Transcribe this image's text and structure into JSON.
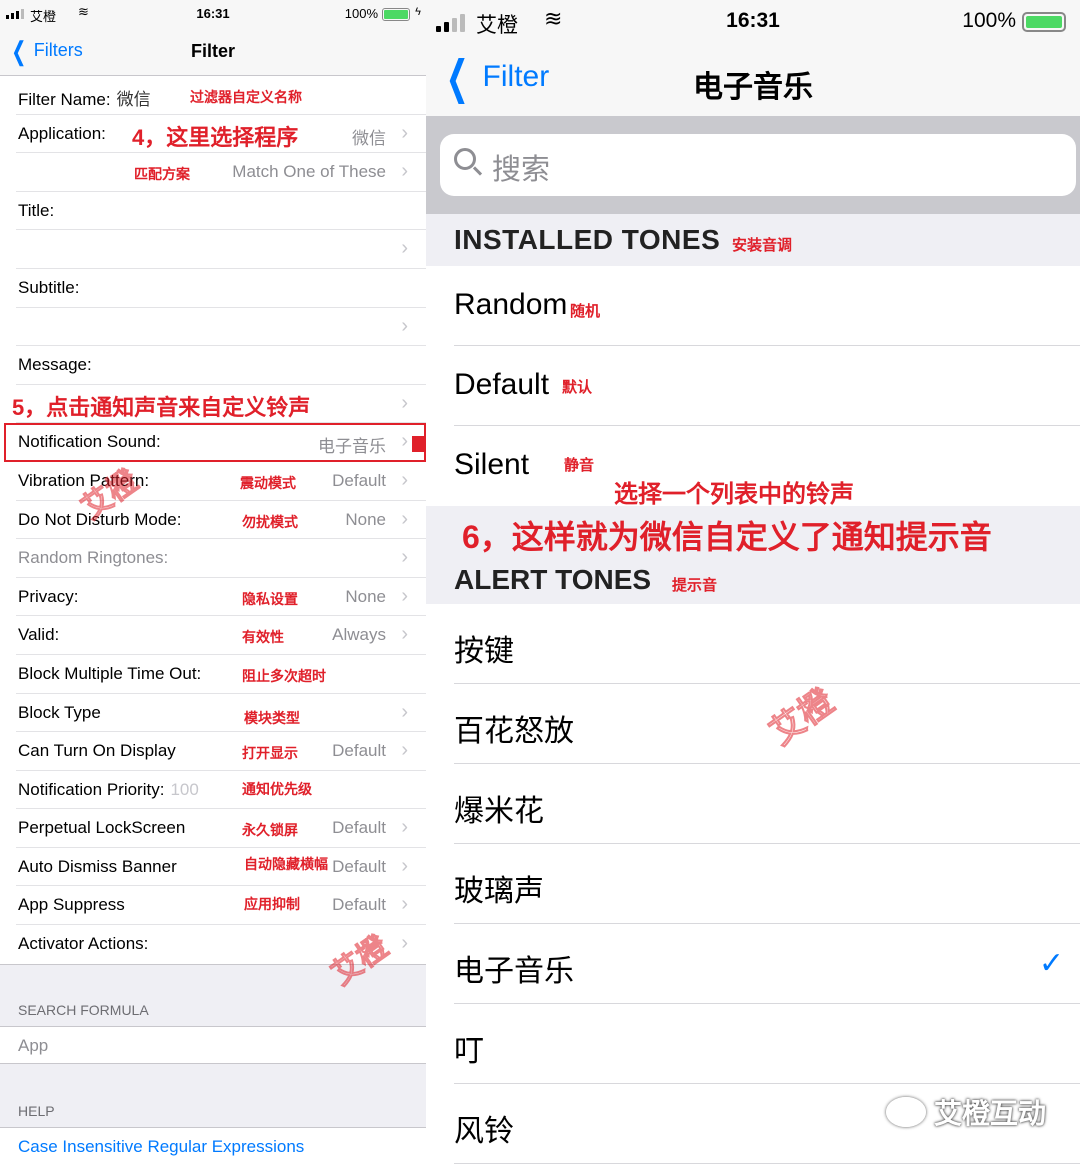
{
  "colors": {
    "accent": "#007aff",
    "annotation": "#e0202a",
    "check": "#007aff"
  },
  "left": {
    "status": {
      "carrier": "艾橙",
      "time": "16:31",
      "battery": "100%"
    },
    "nav": {
      "back": "Filters",
      "title": "Filter"
    },
    "rows": [
      {
        "label": "Filter Name:",
        "inline_value": "微信",
        "note": "过滤器自定义名称"
      },
      {
        "label": "Application:",
        "note": "4，这里选择程序",
        "value": "微信"
      },
      {
        "label": "",
        "note": "匹配方案",
        "value": "Match One of These"
      },
      {
        "label": "Title:"
      },
      {
        "label": ""
      },
      {
        "label": "Subtitle:"
      },
      {
        "label": ""
      },
      {
        "label": "Message:"
      },
      {
        "label": "",
        "note": "5，点击通知声音来自定义铃声"
      },
      {
        "label": "Notification Sound:",
        "value": "电子音乐"
      },
      {
        "label": "Vibration Pattern:",
        "note": "震动模式",
        "value": "Default"
      },
      {
        "label": "Do Not Disturb Mode:",
        "note": "勿扰模式",
        "value": "None"
      },
      {
        "label": "Random Ringtones:"
      },
      {
        "label": "Privacy:",
        "note": "隐私设置",
        "value": "None"
      },
      {
        "label": "Valid:",
        "note": "有效性",
        "value": "Always"
      },
      {
        "label": "Block Multiple Time Out:",
        "note": "阻止多次超时"
      },
      {
        "label": "Block Type",
        "note": "模块类型"
      },
      {
        "label": "Can Turn On Display",
        "note": "打开显示",
        "value": "Default"
      },
      {
        "label": "Notification Priority:",
        "inline_value": "100",
        "note": "通知优先级"
      },
      {
        "label": "Perpetual LockScreen",
        "note": "永久锁屏",
        "value": "Default"
      },
      {
        "label": "Auto Dismiss Banner",
        "note": "自动隐藏横幅",
        "value": "Default"
      },
      {
        "label": "App Suppress",
        "note": "应用抑制",
        "value": "Default"
      },
      {
        "label": "Activator Actions:"
      }
    ],
    "search_formula": {
      "header": "SEARCH FORMULA",
      "value": "App"
    },
    "help": {
      "header": "HELP",
      "link": "Case Insensitive Regular Expressions"
    },
    "stamp": "艾橙"
  },
  "right": {
    "status": {
      "carrier": "艾橙",
      "time": "16:31",
      "battery": "100%"
    },
    "nav": {
      "back": "Filter",
      "title": "电子音乐"
    },
    "search": {
      "placeholder": "搜索"
    },
    "installed": {
      "header": "INSTALLED TONES",
      "header_note": "安装音调",
      "items": [
        {
          "label": "Random",
          "note": "随机"
        },
        {
          "label": "Default",
          "note": "默认"
        },
        {
          "label": "Silent",
          "note": "静音"
        }
      ]
    },
    "annotation_select": "选择一个列表中的铃声",
    "annotation_done": "6，这样就为微信自定义了通知提示音",
    "alert": {
      "header": "ALERT TONES",
      "header_note": "提示音",
      "items": [
        {
          "label": "按键"
        },
        {
          "label": "百花怒放"
        },
        {
          "label": "爆米花"
        },
        {
          "label": "玻璃声"
        },
        {
          "label": "电子音乐",
          "selected": true
        },
        {
          "label": "叮"
        },
        {
          "label": "风铃"
        }
      ]
    },
    "stamp": "艾橙",
    "watermark": "艾橙互动"
  }
}
